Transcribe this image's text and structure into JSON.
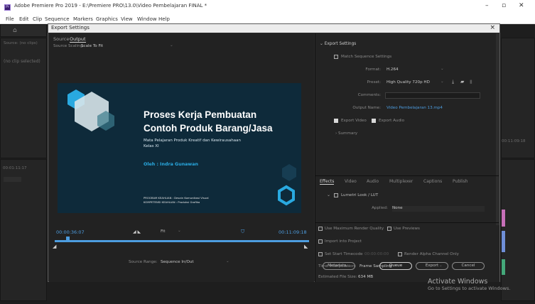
{
  "window": {
    "title": "Adobe Premiere Pro 2019 - E:\\Premiere PRO\\13.0\\Video Pembelajaran FINAL *",
    "app_icon": "Pr",
    "controls": {
      "minimize": "–",
      "maximize": "▫",
      "close": "✕"
    }
  },
  "menu": [
    "File",
    "Edit",
    "Clip",
    "Sequence",
    "Markers",
    "Graphics",
    "View",
    "Window",
    "Help"
  ],
  "background": {
    "left_panel_tab": "Source: (no clips)",
    "left_panel_empty": "(no clip selected)",
    "timecode_left": "00:01:11:17",
    "timecode_right": "00:11:09:18"
  },
  "dialog": {
    "title": "Export Settings",
    "close": "×",
    "tabs": [
      "Source",
      "Output"
    ],
    "active_tab": "Output",
    "source_scaling_label": "Source Scaling:",
    "source_scaling_value": "Scale To Fit",
    "slide": {
      "title_line1": "Proses Kerja Pembuatan",
      "title_line2": "Contoh Produk Barang/Jasa",
      "subtitle_line1": "Mata Pelajaran Produk Kreatif dan Kewirausahaan",
      "subtitle_line2": "Kelas XI",
      "author": "Oleh : Indra Gunawan",
      "footer_line1": "PROGRAM KEAHLIAN : Desain Komunikasi Visual",
      "footer_line2": "KOMPETENSI KEAHLIAN : Produksi Grafika"
    },
    "playback": {
      "current_time": "00:00:36:07",
      "fit_label": "Fit",
      "end_time": "00:11:09:18",
      "source_range_label": "Source Range:",
      "source_range_value": "Sequence In/Out"
    },
    "export_settings": {
      "header": "Export Settings",
      "match_sequence": "Match Sequence Settings",
      "format_label": "Format:",
      "format_value": "H.264",
      "preset_label": "Preset:",
      "preset_value": "High Quality 720p HD",
      "comments_label": "Comments:",
      "comments_value": "",
      "output_name_label": "Output Name:",
      "output_name_value": "Video Pembelajaran 13.mp4",
      "export_video": "Export Video",
      "export_audio": "Export Audio",
      "summary": "Summary"
    },
    "lower_tabs": [
      "Effects",
      "Video",
      "Audio",
      "Multiplexer",
      "Captions",
      "Publish"
    ],
    "active_lower_tab": "Effects",
    "effects": {
      "lumetri": "Lumetri Look / LUT",
      "applied_label": "Applied:",
      "applied_value": "None"
    },
    "options": {
      "max_render_quality": "Use Maximum Render Quality",
      "use_previews": "Use Previews",
      "import_into_project": "Import into Project",
      "set_start_timecode": "Set Start Timecode",
      "start_timecode_value": "00:00:00:00",
      "render_alpha": "Render Alpha Channel Only",
      "time_interpolation_label": "Time Interpolation:",
      "time_interpolation_value": "Frame Sampling",
      "estimated_size_label": "Estimated File Size:",
      "estimated_size_value": "634 MB"
    },
    "buttons": {
      "metadata": "Metadata...",
      "queue": "Queue",
      "export": "Export",
      "cancel": "Cancel"
    }
  },
  "watermark": {
    "line1": "Activate Windows",
    "line2": "Go to Settings to activate Windows."
  },
  "colors": {
    "link": "#4d9de0",
    "slide_bg": "#0e2a3a",
    "slide_accent": "#29a9e0"
  }
}
